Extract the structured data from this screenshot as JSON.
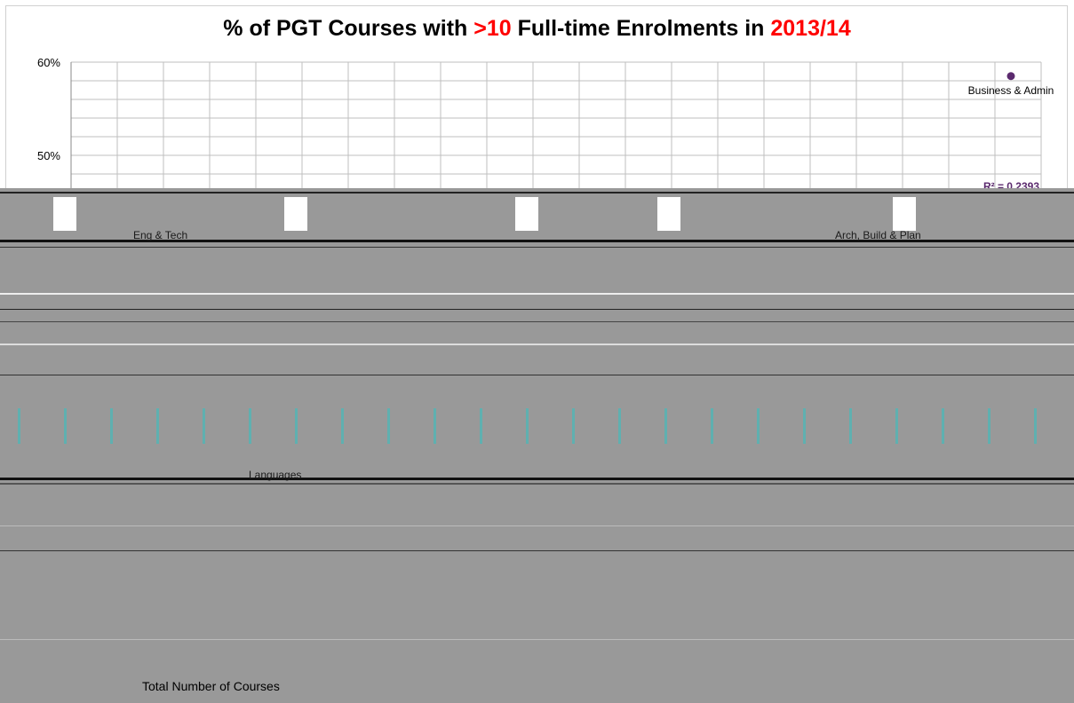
{
  "title": {
    "prefix": "% of PGT Courses with ",
    "highlight_number": ">10",
    "middle": " Full-time Enrolments in ",
    "highlight_year": "2013/14"
  },
  "xlabel": "Total Number of Courses",
  "colors": {
    "title": "#000000",
    "accent": "#ff0000",
    "point": "#5b2a6e",
    "grid": "#bfbfbf",
    "corruption": "#999999"
  },
  "chart_data": {
    "type": "scatter",
    "title": "% of PGT Courses with >10 Full-time Enrolments in 2013/14",
    "xlabel": "Total Number of Courses",
    "ylabel": "",
    "y_ticks": [
      "60%",
      "50%"
    ],
    "grid": true,
    "points": [
      {
        "label": "Business & Admin",
        "y": 0.585
      }
    ],
    "trendline": {
      "r_squared_label": "R² = 0.2393"
    }
  },
  "visible_fragments": {
    "eng_tech": "Eng & Tech",
    "arch_build": "Arch, Build & Plan",
    "languages": "Languages"
  }
}
